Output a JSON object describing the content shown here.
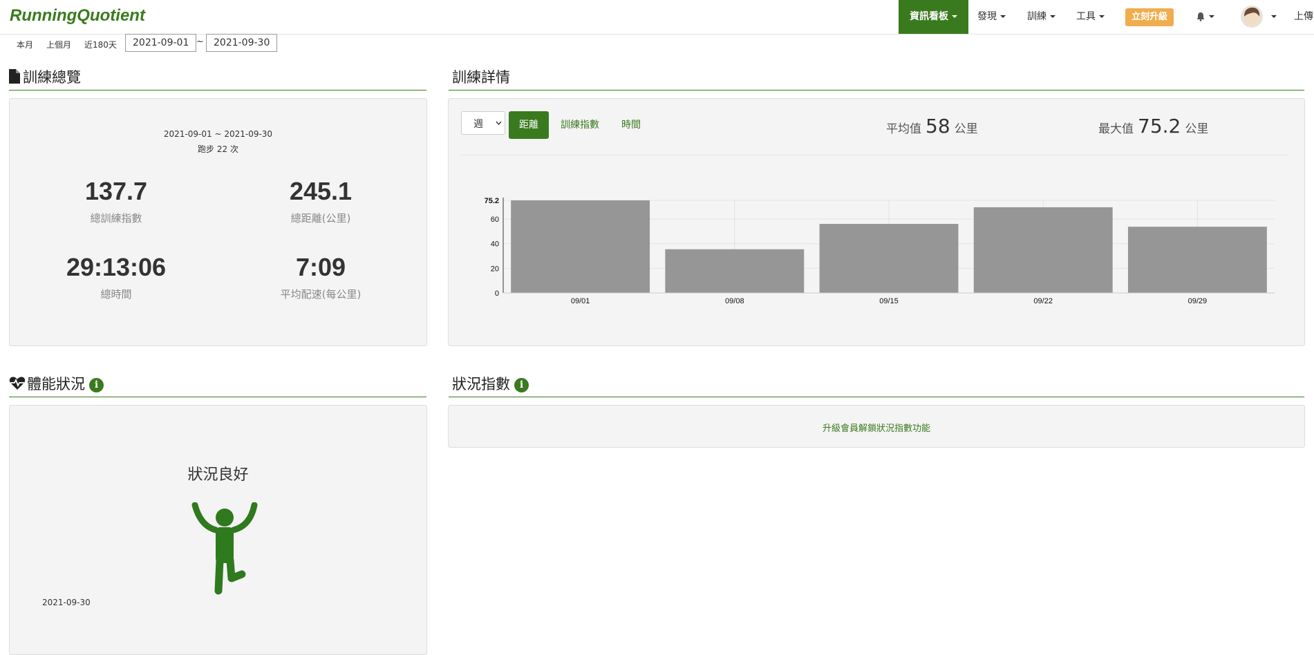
{
  "nav": {
    "brand": "RunningQuotient",
    "dashboard": "資訊看板",
    "discover": "發現",
    "training": "訓練",
    "tools": "工具",
    "upgrade": "立刻升級",
    "upload": "上傳"
  },
  "date_bar": {
    "this_month": "本月",
    "last_month": "上個月",
    "last_180": "近180天",
    "start": "2021-09-01",
    "sep": "~",
    "end": "2021-09-30"
  },
  "overview": {
    "title": "訓練總覽",
    "range": "2021-09-01 ~ 2021-09-30",
    "runs": "跑步 22 次",
    "stats": [
      {
        "value": "137.7",
        "label": "總訓練指數"
      },
      {
        "value": "245.1",
        "label": "總距離(公里)"
      },
      {
        "value": "29:13:06",
        "label": "總時間"
      },
      {
        "value": "7:09",
        "label": "平均配速(每公里)"
      }
    ]
  },
  "details": {
    "title": "訓練詳情",
    "period": "週",
    "metrics": [
      "距離",
      "訓練指數",
      "時間"
    ],
    "avg_label": "平均值",
    "avg_value": "58",
    "avg_unit": "公里",
    "max_label": "最大值",
    "max_value": "75.2",
    "max_unit": "公里"
  },
  "chart_data": {
    "type": "bar",
    "categories": [
      "09/01",
      "09/08",
      "09/15",
      "09/22",
      "09/29"
    ],
    "values": [
      75.2,
      35.5,
      56.1,
      69.6,
      53.8
    ],
    "yticks": [
      "0",
      "20",
      "40",
      "60",
      "75.2"
    ],
    "ylim": [
      0,
      75.2
    ],
    "color": "#969696"
  },
  "fitness": {
    "title": "體能狀況",
    "status": "狀況良好",
    "date": "2021-09-30"
  },
  "condition": {
    "title": "狀況指數",
    "unlock": "升級會員解鎖狀況指數功能"
  },
  "colors": {
    "accent": "#3a7a1e",
    "upgrade": "#f0ad4e",
    "bar": "#969696"
  }
}
